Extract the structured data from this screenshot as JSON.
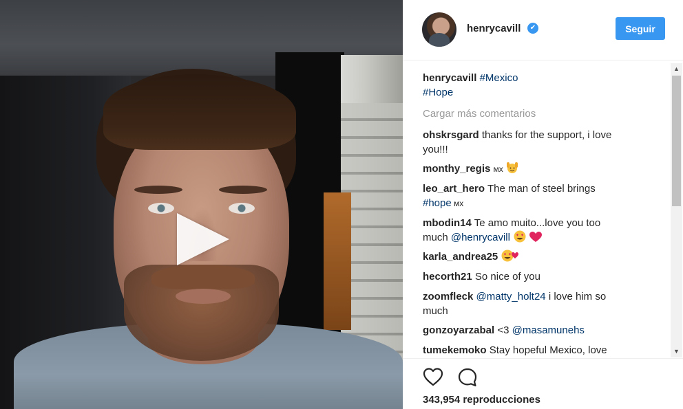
{
  "post": {
    "username": "henrycavill",
    "verified_symbol": "✔",
    "follow_label": "Seguir"
  },
  "caption": {
    "username": "henrycavill",
    "hashtag_1": "#Mexico",
    "hashtag_2": "#Hope"
  },
  "load_more_label": "Cargar más comentarios",
  "comments": [
    {
      "user": "ohskrsgard",
      "text_line1": "thanks for the support, i love",
      "text_line2": "you!!!"
    },
    {
      "user": "monthy_regis",
      "text": "мх"
    },
    {
      "user": "leo_art_hero",
      "text_line1": "The man of steel brings",
      "tag": "#hope",
      "text_after_tag": " мх"
    },
    {
      "user": "mbodin14",
      "text_line1": "Te amo muito...love you too",
      "text_line2": "much ",
      "mention": "@henrycavill"
    },
    {
      "user": "karla_andrea25"
    },
    {
      "user": "hecorth21",
      "text": "So nice of you"
    },
    {
      "user": "zoomfleck",
      "mention": "@matty_holt24",
      "text_after_mention": " i love him so",
      "text_line2": "much"
    },
    {
      "user": "gonzoyarzabal",
      "text": "<3 ",
      "mention": "@masamunehs"
    },
    {
      "user": "tumekemoko",
      "text": "Stay hopeful Mexico, love"
    }
  ],
  "stats": {
    "views": "343,954 reproducciones"
  },
  "icons": {
    "like": "heart-outline-icon",
    "comment": "speech-bubble-icon",
    "play": "play-icon",
    "verified": "verified-badge-icon"
  },
  "colors": {
    "accent": "#3897f0",
    "link": "#003569",
    "muted": "#999999",
    "text": "#262626"
  }
}
